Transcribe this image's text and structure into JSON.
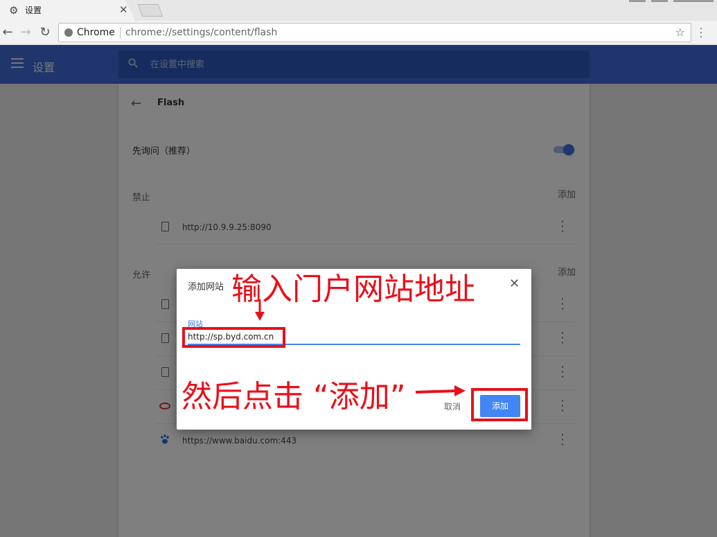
{
  "tab": {
    "title": "设置",
    "icon": "gear-icon"
  },
  "toolbar": {
    "site_label": "Chrome",
    "url": "chrome://settings/content/flash"
  },
  "appbar": {
    "title": "设置",
    "search_placeholder": "在设置中搜索",
    "background": "#3e6ad6"
  },
  "flash": {
    "title": "Flash",
    "ask_label": "先询问（推荐）",
    "ask_enabled": true,
    "block": {
      "label": "禁止",
      "add_label": "添加",
      "sites": [
        "http://10.9.9.25:8090"
      ]
    },
    "allow": {
      "label": "允许",
      "add_label": "添加",
      "sites": [
        "",
        "",
        "",
        "",
        "https://www.baidu.com:443"
      ]
    }
  },
  "dialog": {
    "title": "添加网站",
    "field_label": "网站",
    "field_value": "http://sp.byd.com.cn",
    "cancel_label": "取消",
    "add_label": "添加"
  },
  "annotations": {
    "top": "输入门户网站地址",
    "bottom": "然后点击 “添加”",
    "color": "#e8101a"
  }
}
